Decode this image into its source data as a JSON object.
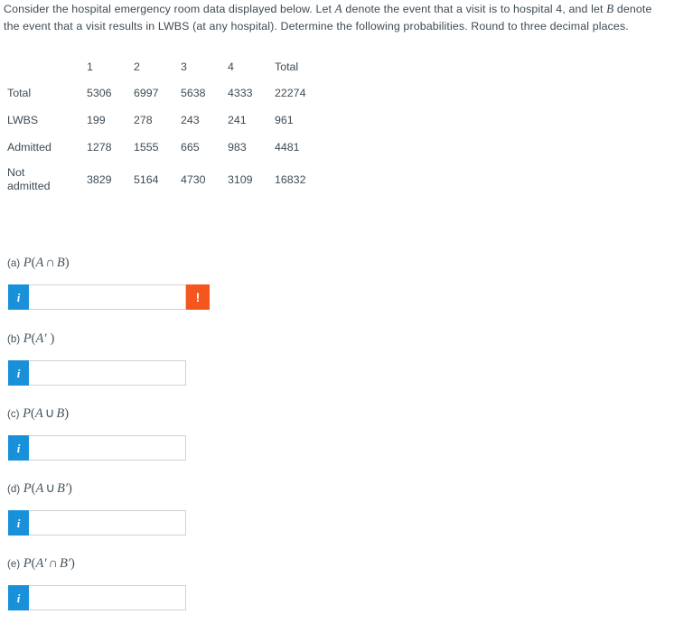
{
  "prompt": {
    "part1": "Consider the hospital emergency room data displayed below. Let ",
    "varA": "A",
    "part2": " denote the event that a visit is to hospital 4, and let ",
    "varB": "B",
    "part3": " denote the event that a visit results in LWBS (at any hospital). Determine the following probabilities. Round to three decimal places."
  },
  "table": {
    "corner": "",
    "columns": [
      "1",
      "2",
      "3",
      "4",
      "Total"
    ],
    "rows": [
      {
        "label": "Total",
        "label2": "",
        "values": [
          "5306",
          "6997",
          "5638",
          "4333",
          "22274"
        ]
      },
      {
        "label": "LWBS",
        "label2": "",
        "values": [
          "199",
          "278",
          "243",
          "241",
          "961"
        ]
      },
      {
        "label": "Admitted",
        "label2": "",
        "values": [
          "1278",
          "1555",
          "665",
          "983",
          "4481"
        ]
      },
      {
        "label": "Not",
        "label2": "admitted",
        "values": [
          "3829",
          "5164",
          "4730",
          "3109",
          "16832"
        ]
      }
    ]
  },
  "questions": [
    {
      "tag": "(a)",
      "P": "P",
      "expr_open": "(",
      "operand1": "A",
      "operator": "∩",
      "operand2": "B",
      "expr_close": ")",
      "info_label": "i",
      "value": "",
      "placeholder": "",
      "warn_label": "!",
      "has_warning": true
    },
    {
      "tag": "(b)",
      "P": "P",
      "expr_open": "(",
      "operand1": "A′",
      "operator": "",
      "operand2": "",
      "expr_close": ")",
      "info_label": "i",
      "value": "",
      "placeholder": "",
      "warn_label": "",
      "has_warning": false
    },
    {
      "tag": "(c)",
      "P": "P",
      "expr_open": "(",
      "operand1": "A",
      "operator": "∪",
      "operand2": "B",
      "expr_close": ")",
      "info_label": "i",
      "value": "",
      "placeholder": "",
      "warn_label": "",
      "has_warning": false
    },
    {
      "tag": "(d)",
      "P": "P",
      "expr_open": "(",
      "operand1": "A",
      "operator": "∪",
      "operand2": "B′",
      "expr_close": ")",
      "info_label": "i",
      "value": "",
      "placeholder": "",
      "warn_label": "",
      "has_warning": false
    },
    {
      "tag": "(e)",
      "P": "P",
      "expr_open": "(",
      "operand1": "A′",
      "operator": "∩",
      "operand2": "B′",
      "expr_close": ")",
      "info_label": "i",
      "value": "",
      "placeholder": "",
      "warn_label": "",
      "has_warning": false
    }
  ],
  "colors": {
    "text": "#3d4b55",
    "info_blue": "#1890da",
    "warn_orange": "#f4561d",
    "input_border": "#cdd2d6"
  }
}
